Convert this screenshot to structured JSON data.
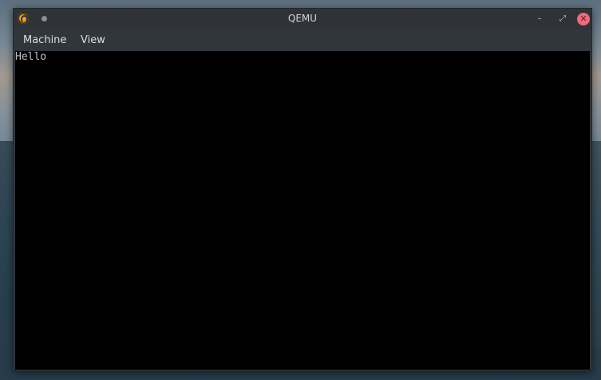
{
  "window": {
    "title": "QEMU",
    "controls": {
      "minimize_icon": "minimize-icon",
      "maximize_icon": "maximize-icon",
      "close_icon": "close-icon"
    }
  },
  "menubar": {
    "items": [
      {
        "label": "Machine"
      },
      {
        "label": "View"
      }
    ]
  },
  "screen": {
    "text": "Hello"
  },
  "colors": {
    "window_bg": "#31363b",
    "close_button": "#ed6a7a",
    "app_icon": "#e7a321",
    "screen_bg": "#000000",
    "console_fg": "#c0c0c0"
  }
}
